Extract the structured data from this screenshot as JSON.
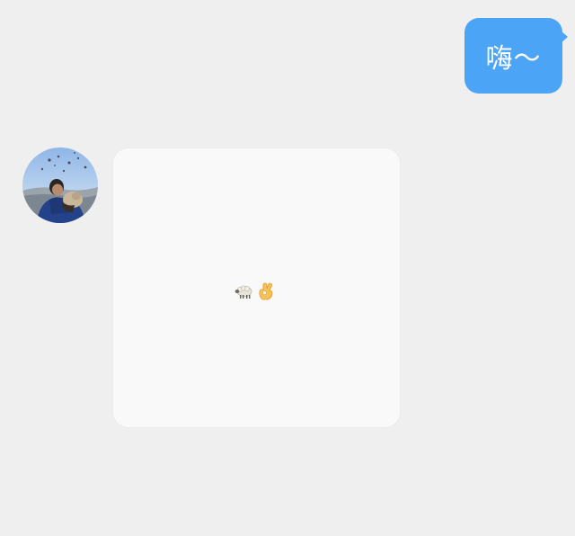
{
  "messages": {
    "outgoing": {
      "text": "嗨～",
      "bubble_color": "#4ba4f5",
      "text_color": "#ffffff"
    },
    "incoming": {
      "sender_avatar": "user-avatar-photo",
      "sticker": {
        "icons": [
          "sheep-icon",
          "ok-hand-icon"
        ],
        "card_color": "#f9f9f9"
      }
    }
  },
  "background_color": "#efefef"
}
